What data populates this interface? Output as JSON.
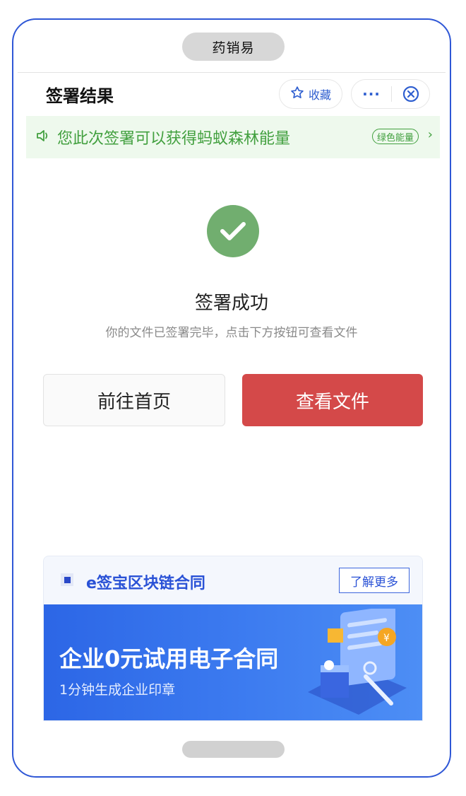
{
  "app": {
    "title": "药销易"
  },
  "header": {
    "title": "签署结果",
    "favorite_label": "收藏",
    "more_label": "···"
  },
  "banner": {
    "text": "您此次签署可以获得蚂蚁森林能量",
    "badge": "绿色能量",
    "chevron": "›"
  },
  "result": {
    "title": "签署成功",
    "description": "你的文件已签署完毕，点击下方按钮可查看文件",
    "home_button": "前往首页",
    "view_button": "查看文件"
  },
  "ad": {
    "title": "e签宝区块链合同",
    "more_button": "了解更多",
    "slogan": "企业0元试用电子合同",
    "subtitle": "1分钟生成企业印章"
  },
  "colors": {
    "accent_blue": "#2f57d6",
    "success_green": "#71ae6f",
    "banner_green": "#42a03f",
    "primary_red": "#d44949"
  },
  "icons": [
    "star-icon",
    "more-icon",
    "close-circle-icon",
    "speaker-icon",
    "chevron-right-icon",
    "check-icon",
    "ad-logo-icon"
  ]
}
